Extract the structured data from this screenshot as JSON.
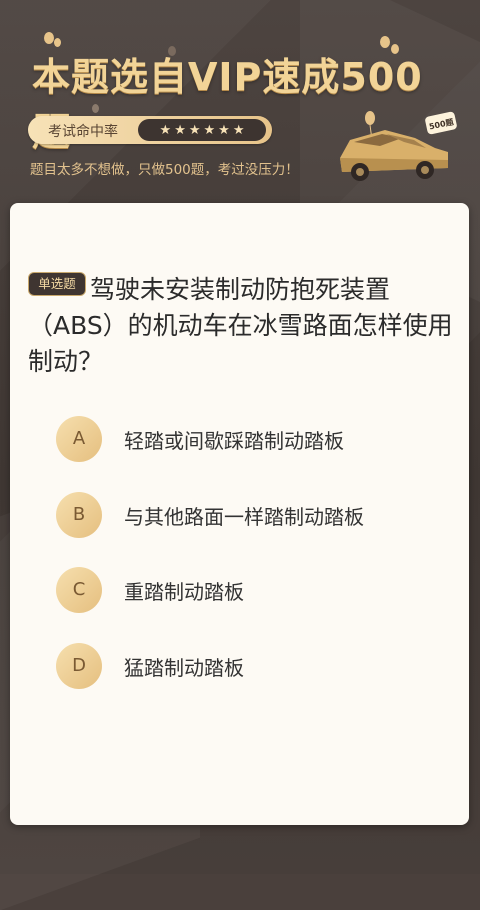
{
  "hero": {
    "title": "本题选自VIP速成500题",
    "rate_label": "考试命中率",
    "stars": [
      "★",
      "★",
      "★",
      "★",
      "★",
      "★"
    ],
    "subtitle": "题目太多不想做，只做500题，考过没压力！",
    "car_badge": "500题"
  },
  "question": {
    "type": "单选题",
    "text": "驾驶未安装制动防抱死装置（ABS）的机动车在冰雪路面怎样使用制动？"
  },
  "options": [
    {
      "letter": "A",
      "text": "轻踏或间歇踩踏制动踏板"
    },
    {
      "letter": "B",
      "text": "与其他路面一样踏制动踏板"
    },
    {
      "letter": "C",
      "text": "重踏制动踏板"
    },
    {
      "letter": "D",
      "text": "猛踏制动踏板"
    }
  ],
  "colors": {
    "accent_gold": "#e7c48a",
    "background_dark": "#4a403c",
    "card": "#fdfaf4"
  }
}
